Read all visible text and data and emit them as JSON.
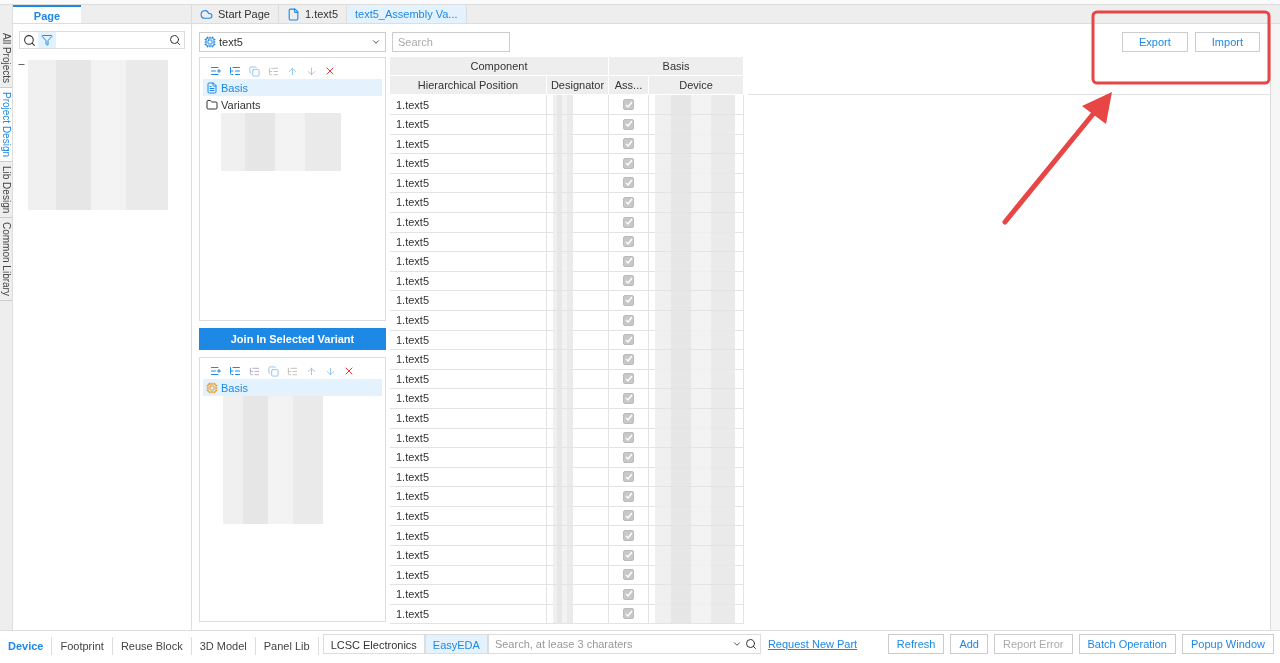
{
  "side_tabs": [
    {
      "label": "All Projects",
      "selected": false
    },
    {
      "label": "Project Design",
      "selected": true
    },
    {
      "label": "Lib Design",
      "selected": false
    },
    {
      "label": "Common Library",
      "selected": false
    }
  ],
  "left_panel": {
    "tabs": [
      {
        "label": "Page",
        "selected": true
      }
    ]
  },
  "doc_tabs": [
    {
      "label": "Start Page",
      "kind": "home",
      "selected": false
    },
    {
      "label": "1.text5",
      "kind": "file",
      "selected": false
    },
    {
      "label": "text5_Assembly Va...",
      "kind": "plain",
      "selected": true
    }
  ],
  "board_select": {
    "value": "text5"
  },
  "search": {
    "placeholder": "Search"
  },
  "actions": [
    {
      "label": "Export"
    },
    {
      "label": "Import"
    }
  ],
  "variant_tree": {
    "items": [
      {
        "label": "Basis",
        "kind": "basis",
        "selected": true
      },
      {
        "label": "Variants",
        "kind": "folder",
        "selected": false
      }
    ]
  },
  "join_button": "Join In Selected Variant",
  "assembly_tree": {
    "items": [
      {
        "label": "Basis",
        "kind": "chip",
        "selected": true
      }
    ]
  },
  "table": {
    "groups": [
      {
        "label": "Component",
        "columns": [
          "Hierarchical Position",
          "Designator"
        ]
      },
      {
        "label": "Basis",
        "columns": [
          "Ass...",
          "Device"
        ]
      }
    ],
    "rows": [
      {
        "position": "1.text5",
        "assembled": true
      },
      {
        "position": "1.text5",
        "assembled": true
      },
      {
        "position": "1.text5",
        "assembled": true
      },
      {
        "position": "1.text5",
        "assembled": true
      },
      {
        "position": "1.text5",
        "assembled": true
      },
      {
        "position": "1.text5",
        "assembled": true
      },
      {
        "position": "1.text5",
        "assembled": true
      },
      {
        "position": "1.text5",
        "assembled": true
      },
      {
        "position": "1.text5",
        "assembled": true
      },
      {
        "position": "1.text5",
        "assembled": true
      },
      {
        "position": "1.text5",
        "assembled": true
      },
      {
        "position": "1.text5",
        "assembled": true
      },
      {
        "position": "1.text5",
        "assembled": true
      },
      {
        "position": "1.text5",
        "assembled": true
      },
      {
        "position": "1.text5",
        "assembled": true
      },
      {
        "position": "1.text5",
        "assembled": true
      },
      {
        "position": "1.text5",
        "assembled": true
      },
      {
        "position": "1.text5",
        "assembled": true
      },
      {
        "position": "1.text5",
        "assembled": true
      },
      {
        "position": "1.text5",
        "assembled": true
      },
      {
        "position": "1.text5",
        "assembled": true
      },
      {
        "position": "1.text5",
        "assembled": true
      },
      {
        "position": "1.text5",
        "assembled": true
      },
      {
        "position": "1.text5",
        "assembled": true
      },
      {
        "position": "1.text5",
        "assembled": true
      },
      {
        "position": "1.text5",
        "assembled": true
      },
      {
        "position": "1.text5",
        "assembled": true
      }
    ]
  },
  "library_bar": {
    "tabs": [
      {
        "label": "Device",
        "selected": true
      },
      {
        "label": "Footprint",
        "selected": false
      },
      {
        "label": "Reuse Block",
        "selected": false
      },
      {
        "label": "3D Model",
        "selected": false
      },
      {
        "label": "Panel Lib",
        "selected": false
      }
    ],
    "sources": [
      {
        "label": "LCSC Electronics",
        "selected": false
      },
      {
        "label": "EasyEDA",
        "selected": true
      }
    ],
    "search": {
      "placeholder": "Search, at lease 3 charaters"
    },
    "link": "Request New Part",
    "buttons": [
      {
        "label": "Refresh",
        "disabled": false
      },
      {
        "label": "Add",
        "disabled": false
      },
      {
        "label": "Report Error",
        "disabled": true
      },
      {
        "label": "Batch Operation",
        "disabled": false
      },
      {
        "label": "Popup Window",
        "disabled": false
      }
    ]
  }
}
